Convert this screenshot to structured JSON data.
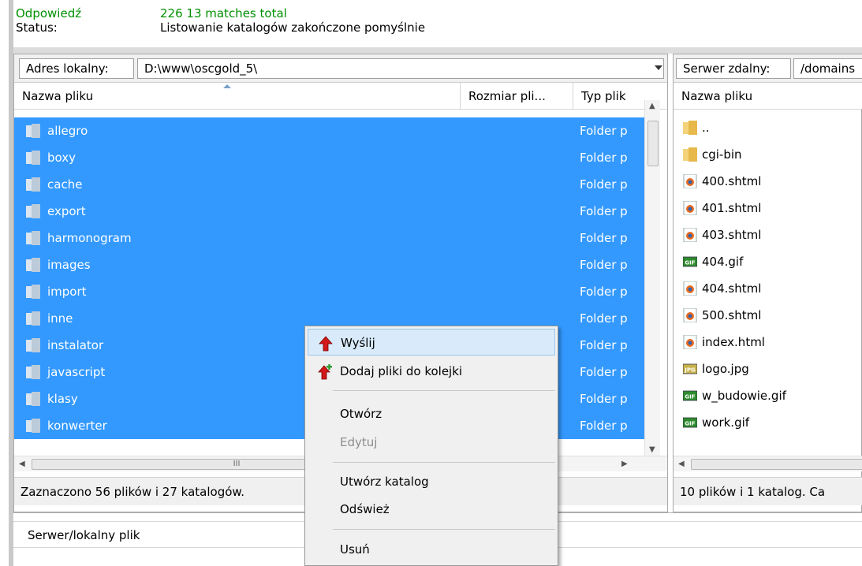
{
  "log": [
    {
      "key": "Odpowiedź",
      "value": "226 13 matches total"
    },
    {
      "key": "Status:",
      "value": "Listowanie katalogów zakończone pomyślnie"
    }
  ],
  "local": {
    "address_label": "Adres lokalny:",
    "path": "D:\\www\\oscgold_5\\",
    "columns": [
      "Nazwa pliku",
      "Rozmiar pli...",
      "Typ plik"
    ],
    "rows": [
      {
        "name": "allegro",
        "type": "Folder p"
      },
      {
        "name": "boxy",
        "type": "Folder p"
      },
      {
        "name": "cache",
        "type": "Folder p"
      },
      {
        "name": "export",
        "type": "Folder p"
      },
      {
        "name": "harmonogram",
        "type": "Folder p"
      },
      {
        "name": "images",
        "type": "Folder p"
      },
      {
        "name": "import",
        "type": "Folder p"
      },
      {
        "name": "inne",
        "type": "Folder p"
      },
      {
        "name": "instalator",
        "type": "Folder p"
      },
      {
        "name": "javascript",
        "type": "Folder p"
      },
      {
        "name": "klasy",
        "type": "Folder p"
      },
      {
        "name": "konwerter",
        "type": "Folder p"
      }
    ],
    "status": "Zaznaczono 56 plików i 27 katalogów.",
    "hscroll_glyph": "III"
  },
  "remote": {
    "address_label": "Serwer zdalny:",
    "path": "/domains",
    "column": "Nazwa pliku",
    "rows": [
      {
        "name": "..",
        "icon": "folder-icon"
      },
      {
        "name": "cgi-bin",
        "icon": "folder-icon"
      },
      {
        "name": "400.shtml",
        "icon": "html-file-icon"
      },
      {
        "name": "401.shtml",
        "icon": "html-file-icon"
      },
      {
        "name": "403.shtml",
        "icon": "html-file-icon"
      },
      {
        "name": "404.gif",
        "icon": "gif-file-icon",
        "badge": "GIF"
      },
      {
        "name": "404.shtml",
        "icon": "html-file-icon"
      },
      {
        "name": "500.shtml",
        "icon": "html-file-icon"
      },
      {
        "name": "index.html",
        "icon": "html-file-icon"
      },
      {
        "name": "logo.jpg",
        "icon": "jpg-file-icon",
        "badge": "JPG"
      },
      {
        "name": "w_budowie.gif",
        "icon": "gif-file-icon",
        "badge": "GIF"
      },
      {
        "name": "work.gif",
        "icon": "gif-file-icon",
        "badge": "GIF"
      }
    ],
    "status": "10 plików i 1 katalog. Ca"
  },
  "queue": {
    "column": "Serwer/lokalny plik"
  },
  "context_menu": {
    "upload": "Wyślij",
    "add_to_queue": "Dodaj pliki do kolejki",
    "open": "Otwórz",
    "edit": "Edytuj",
    "create_dir": "Utwórz katalog",
    "refresh": "Odśwież",
    "delete": "Usuń"
  },
  "colors": {
    "selection": "#3399ff",
    "log_green": "#009000",
    "menu_highlight": "#d9ebfb"
  }
}
